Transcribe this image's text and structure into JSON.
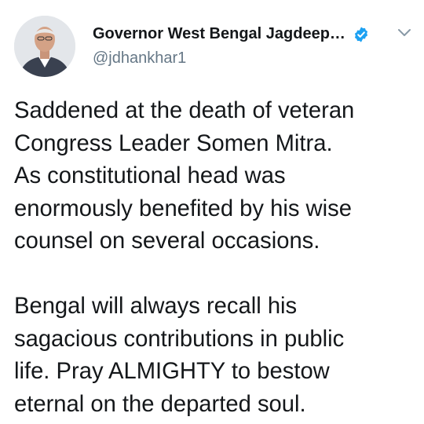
{
  "tweet": {
    "author": {
      "display_name": "Governor West Bengal Jagdeep…",
      "handle": "@jdhankhar1"
    },
    "icons": {
      "avatar": "profile-photo",
      "verified": "verified-badge-icon",
      "menu": "chevron-down-icon"
    },
    "colors": {
      "verified": "#1da1f2",
      "handle": "#657786",
      "text": "#14171a"
    },
    "paragraphs": [
      "Saddened at the death of veteran\nCongress Leader Somen Mitra.\nAs constitutional head was\nenormously benefited by his wise\ncounsel on several occasions.",
      "Bengal will always recall his\nsagacious contributions in public\nlife. Pray ALMIGHTY to bestow\neternal on the departed soul."
    ]
  }
}
